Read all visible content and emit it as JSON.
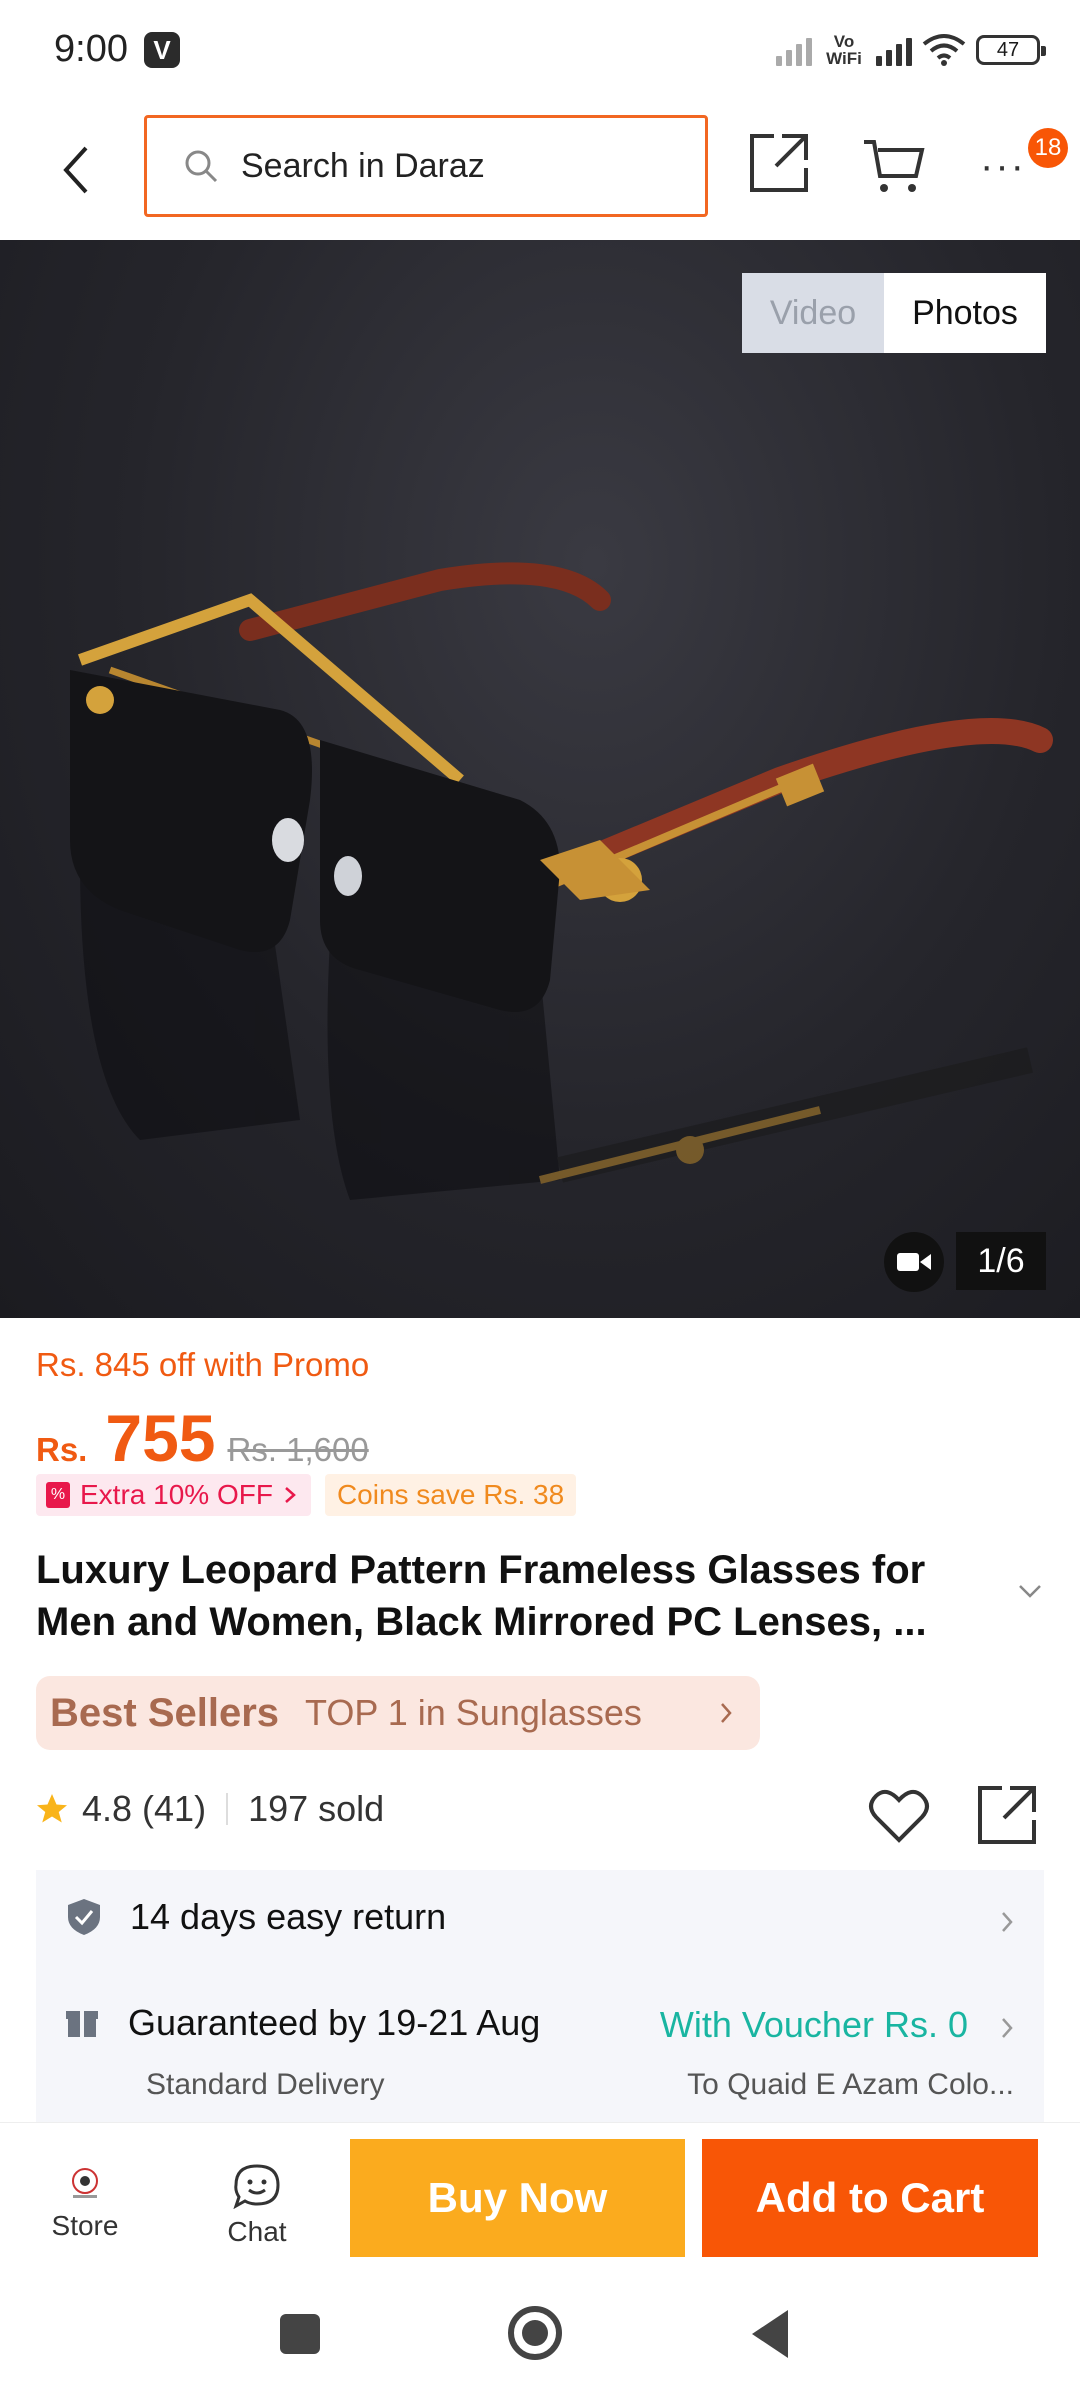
{
  "status_bar": {
    "time": "9:00",
    "app_badge": "V",
    "volte": "Vo WiFi",
    "battery": "47"
  },
  "header": {
    "search_placeholder": "Search in Daraz",
    "more_badge": "18"
  },
  "gallery": {
    "video_tab": "Video",
    "photos_tab": "Photos",
    "counter": "1/6"
  },
  "product": {
    "promo_text": "Rs. 845 off with Promo",
    "currency": "Rs.",
    "price": "755",
    "original_price": "Rs. 1,600",
    "extra_tag": "Extra 10% OFF",
    "coins_tag": "Coins save Rs. 38",
    "title": "Luxury Leopard Pattern Frameless Glasses for Men and Women, Black Mirrored PC Lenses, ...",
    "best_sellers_label": "Best Sellers",
    "best_sellers_rank": "TOP 1 in Sunglasses",
    "rating": "4.8",
    "review_count": "(41)",
    "sold": "197 sold"
  },
  "services": {
    "return_policy": "14 days easy return",
    "delivery_guarantee": "Guaranteed by 19-21 Aug",
    "delivery_type": "Standard Delivery",
    "voucher": "With Voucher Rs. 0",
    "destination": "To Quaid E Azam Colo..."
  },
  "bottom_bar": {
    "store_label": "Store",
    "chat_label": "Chat",
    "buy_now": "Buy Now",
    "add_to_cart": "Add to Cart"
  },
  "colors": {
    "accent": "#f85606",
    "buy_now": "#fbab1e",
    "voucher": "#19b5a1",
    "promo": "#f05a12"
  }
}
